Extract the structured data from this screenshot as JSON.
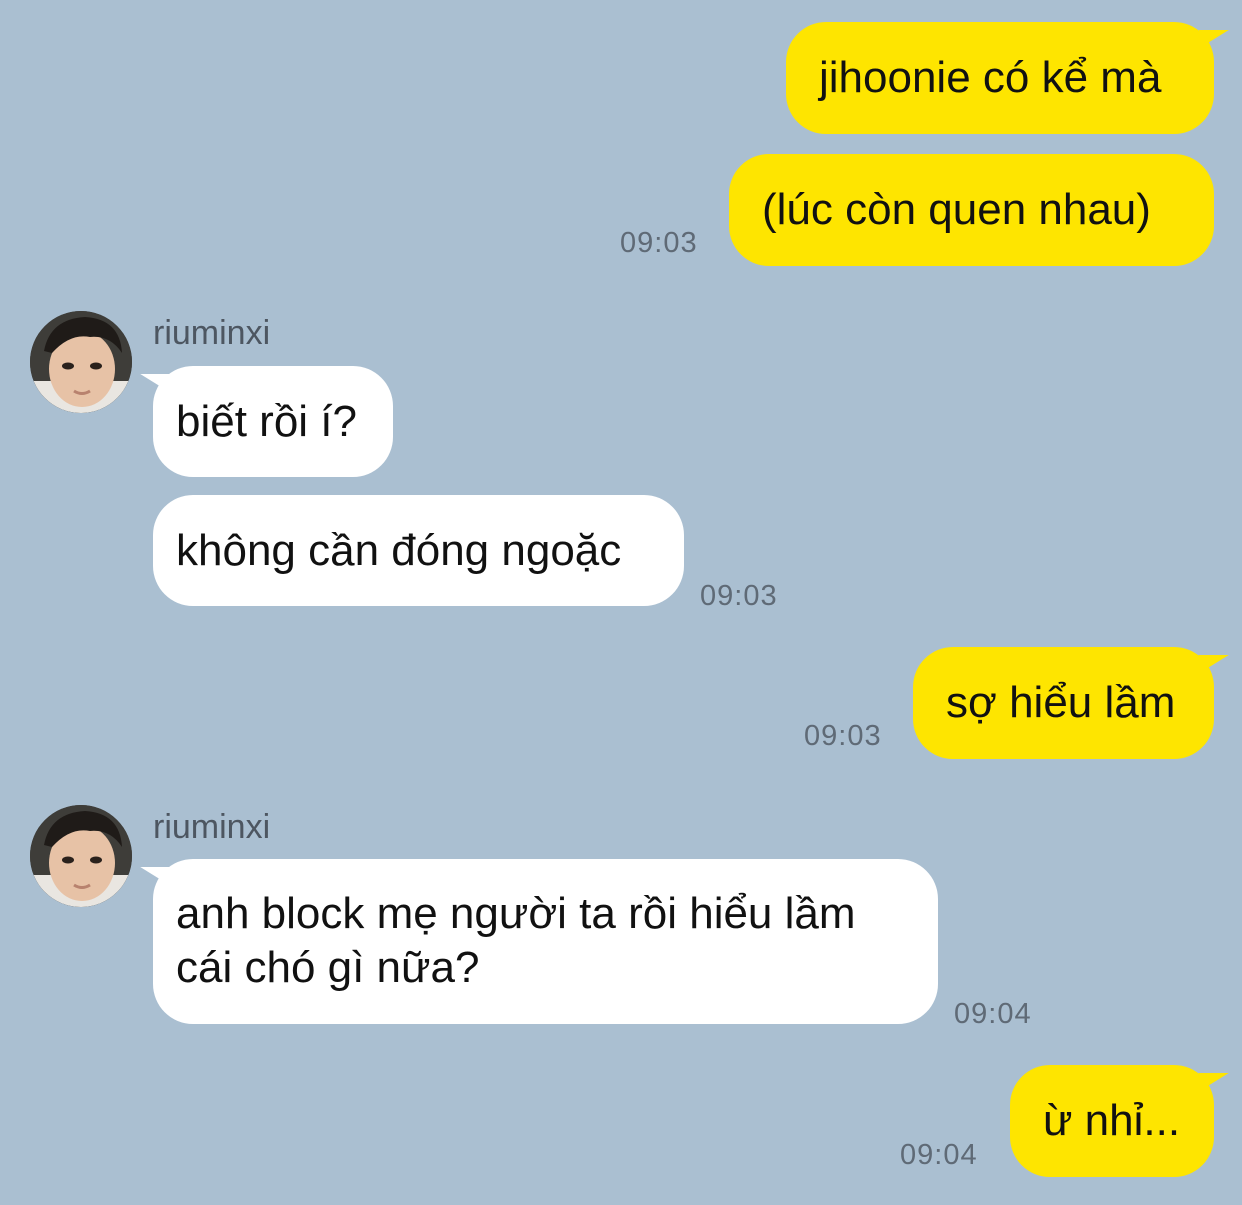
{
  "chat": {
    "messages": [
      {
        "id": "m1",
        "from": "me",
        "text": "jihoonie có kể mà"
      },
      {
        "id": "m2",
        "from": "me",
        "text": "(lúc còn quen nhau)",
        "time": "09:03"
      },
      {
        "id": "m3",
        "from": "them",
        "sender": "riuminxi",
        "text": "biết rồi í?"
      },
      {
        "id": "m4",
        "from": "them",
        "text": "không cần đóng ngoặc",
        "time": "09:03"
      },
      {
        "id": "m5",
        "from": "me",
        "text": "sợ hiểu lầm",
        "time": "09:03"
      },
      {
        "id": "m6",
        "from": "them",
        "sender": "riuminxi",
        "text": "anh block mẹ người ta rồi hiểu lầm cái chó gì nữa?",
        "time": "09:04"
      },
      {
        "id": "m7",
        "from": "me",
        "text": "ừ nhỉ...",
        "time": "09:04"
      }
    ]
  },
  "colors": {
    "background": "#aabfd1",
    "my_bubble": "#fee500",
    "their_bubble": "#ffffff",
    "timestamp": "#5f6a76",
    "sender_name": "#4d5661"
  }
}
